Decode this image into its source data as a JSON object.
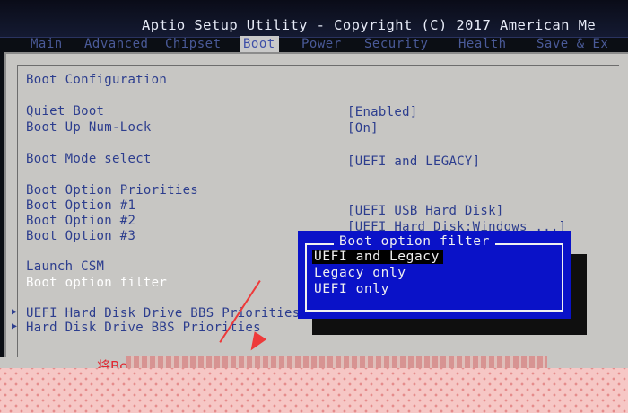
{
  "header": {
    "title": "Aptio Setup Utility - Copyright (C) 2017 American Me",
    "tabs": [
      {
        "label": "Main"
      },
      {
        "label": "Advanced"
      },
      {
        "label": "Chipset"
      },
      {
        "label": "Boot",
        "active": true
      },
      {
        "label": "Power"
      },
      {
        "label": "Security"
      },
      {
        "label": "Health"
      },
      {
        "label": "Save & Ex"
      }
    ]
  },
  "boot": {
    "section_title": "Boot Configuration",
    "quiet_boot": {
      "label": "Quiet Boot",
      "value": "[Enabled]"
    },
    "numlock": {
      "label": "Boot Up Num-Lock",
      "value": "[On]"
    },
    "boot_mode": {
      "label": "Boot Mode select",
      "value": "[UEFI and LEGACY]"
    },
    "priorities_title": "Boot Option Priorities",
    "options": [
      {
        "label": "Boot Option #1",
        "value": "[UEFI USB Hard Disk]"
      },
      {
        "label": "Boot Option #2",
        "value": "[UEFI Hard Disk:Windows ...]"
      },
      {
        "label": "Boot Option #3",
        "value": ""
      }
    ],
    "launch_csm": "Launch CSM",
    "filter_label": "Boot option filter",
    "submenus": [
      {
        "label": "UEFI Hard Disk Drive BBS Priorities"
      },
      {
        "label": "Hard Disk Drive BBS Priorities"
      }
    ]
  },
  "popup": {
    "title": "Boot option filter",
    "options": [
      "UEFI and Legacy",
      "Legacy only",
      "UEFI only"
    ],
    "selected": "UEFI and Legacy"
  },
  "caption": {
    "text": "将Bo"
  },
  "colors": {
    "panel_bg": "#c7c6c3",
    "label_blue": "#2c3d8e",
    "popup_blue": "#0a12c8",
    "annotation_red": "#ee3a3a"
  }
}
